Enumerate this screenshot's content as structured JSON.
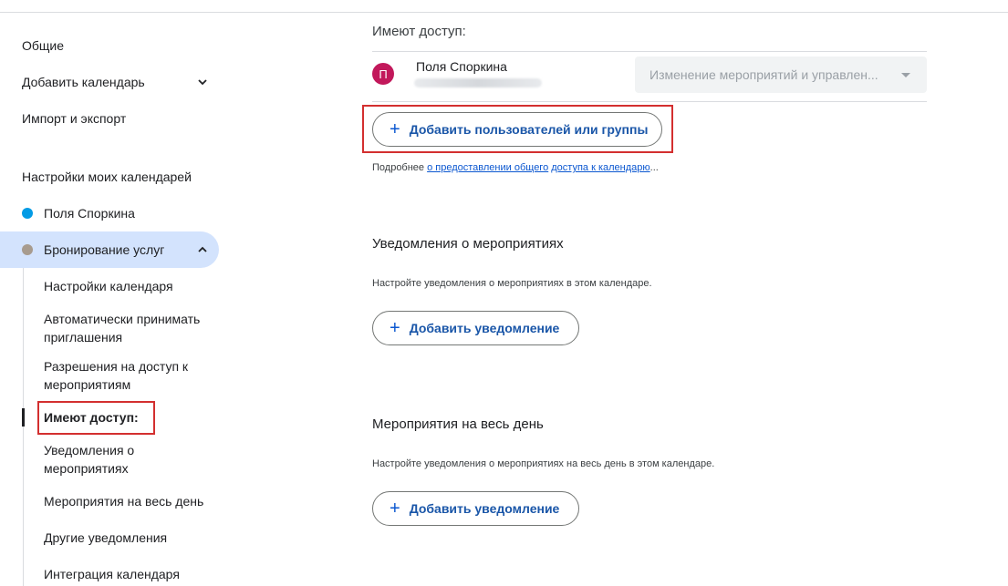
{
  "sidebar": {
    "general": "Общие",
    "add_calendar": "Добавить календарь",
    "import_export": "Импорт и экспорт",
    "my_calendars_title": "Настройки моих календарей",
    "calendars": [
      {
        "label": "Поля Споркина",
        "color": "#039be5"
      },
      {
        "label": "Бронирование услуг",
        "color": "#a79b8e"
      }
    ],
    "sub_items": [
      "Настройки календаря",
      "Автоматически принимать приглашения",
      "Разрешения на доступ к мероприятиям",
      "Имеют доступ:",
      "Уведомления о мероприятиях",
      "Мероприятия на весь день",
      "Другие уведомления",
      "Интеграция календаря"
    ]
  },
  "main": {
    "access_title": "Имеют доступ:",
    "user": {
      "initial": "П",
      "name": "Поля Споркина",
      "permission": "Изменение мероприятий и управлен..."
    },
    "add_users_button": "Добавить пользователей или группы",
    "hint_prefix": "Подробнее ",
    "hint_link1": "о предоставлении общего",
    "hint_link2": "доступа к календарю",
    "hint_suffix": "...",
    "event_notifications": {
      "title": "Уведомления о мероприятиях",
      "desc": "Настройте уведомления о мероприятиях в этом календаре.",
      "button": "Добавить уведомление"
    },
    "allday": {
      "title": "Мероприятия на весь день",
      "desc": "Настройте уведомления о мероприятиях на весь день в этом календаре.",
      "button": "Добавить уведомление"
    }
  }
}
